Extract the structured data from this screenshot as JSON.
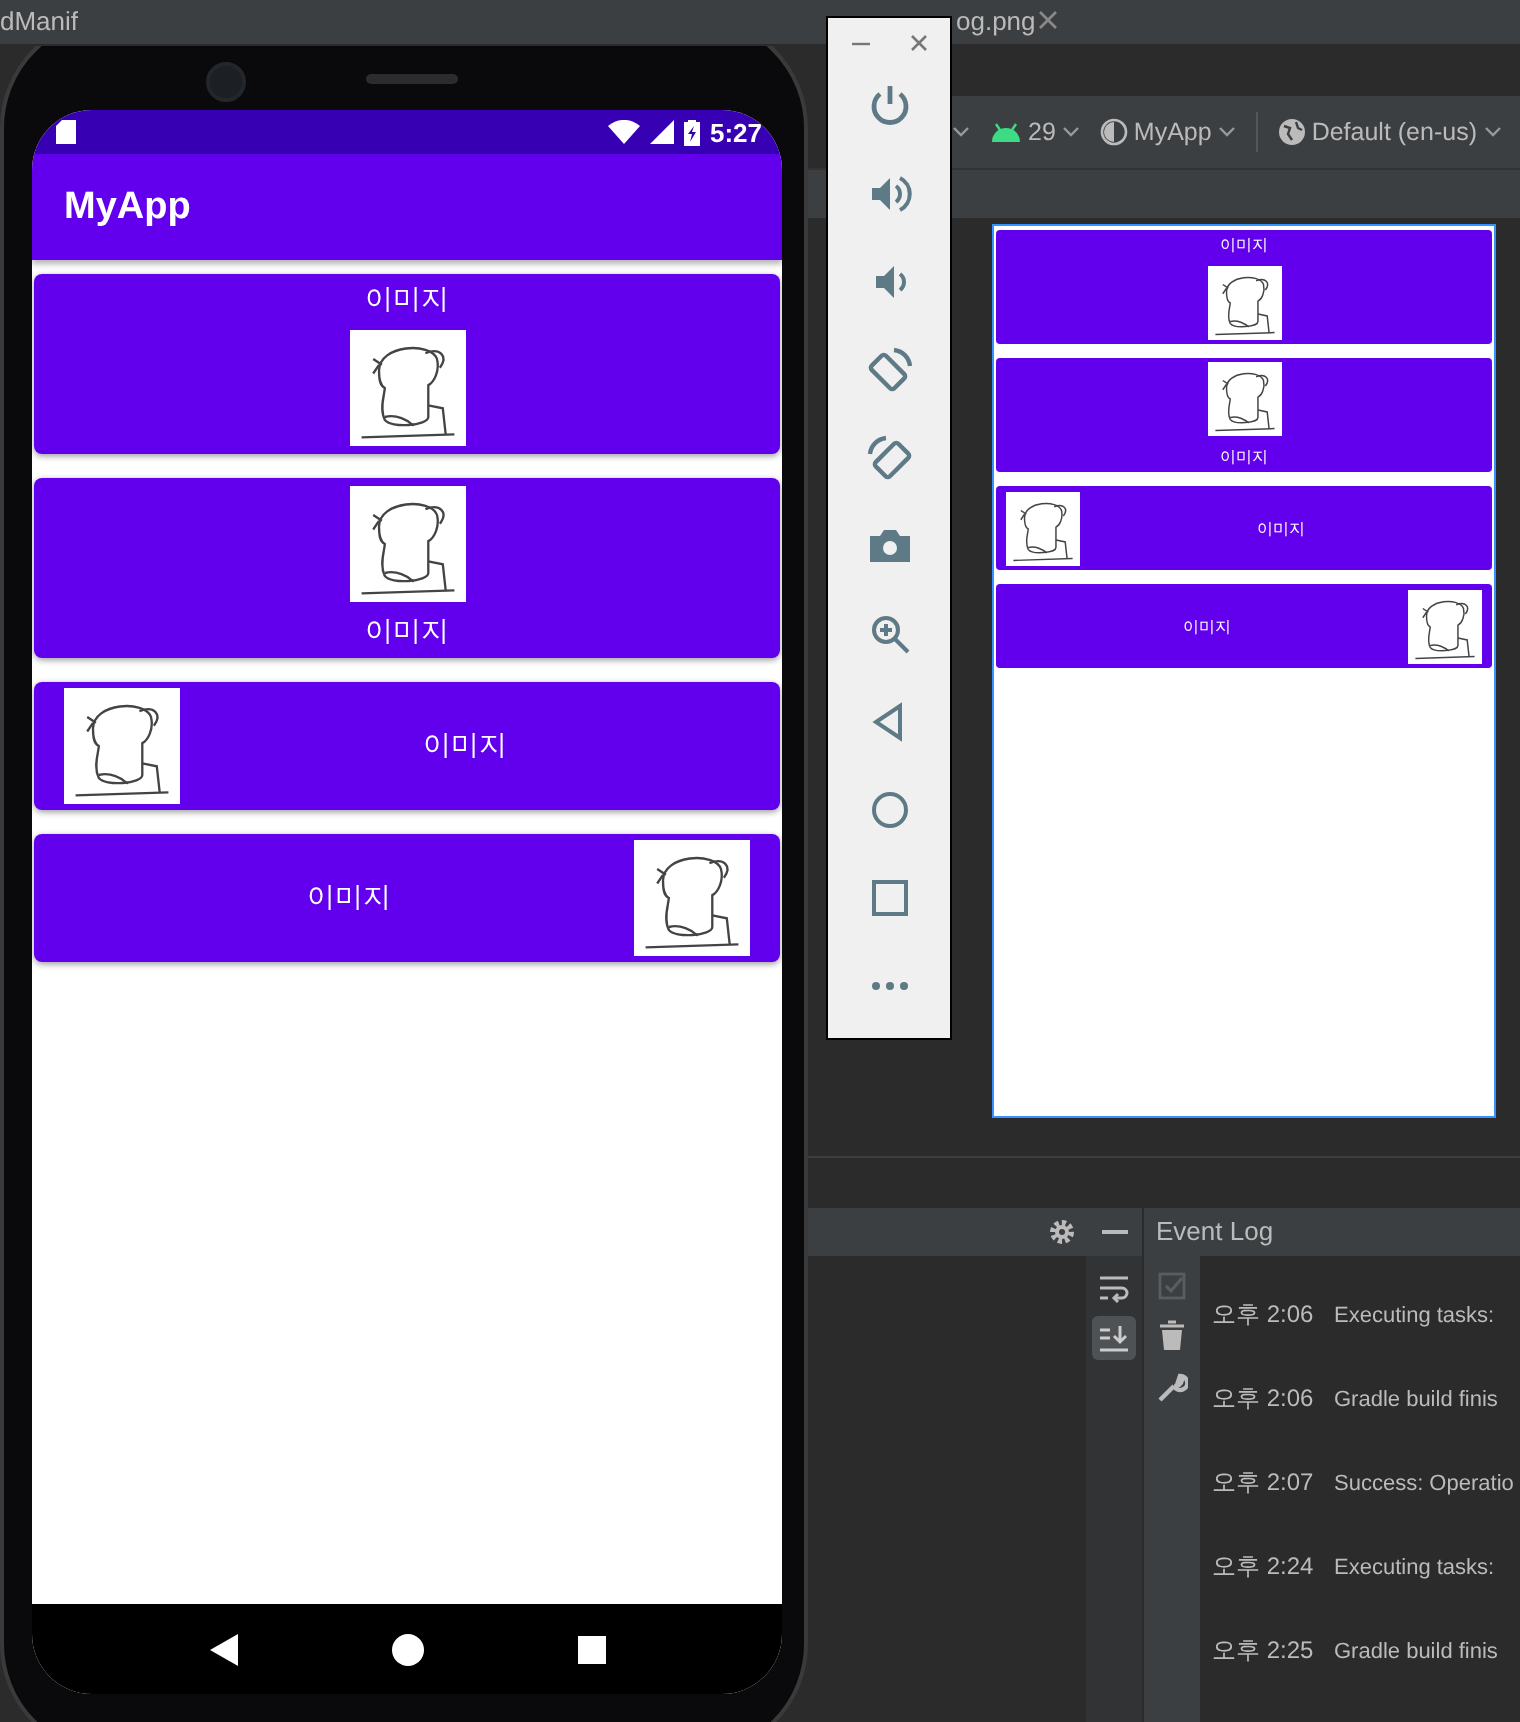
{
  "ide_tabs": [
    {
      "label": "dManif",
      "closable": false
    },
    {
      "label": "og.png",
      "closable": true
    }
  ],
  "toolbar": {
    "api_level": "29",
    "app": "MyApp",
    "locale": "Default (en-us)"
  },
  "device": {
    "status_bar": {
      "time": "5:27"
    },
    "app_bar": {
      "title": "MyApp"
    },
    "cards": [
      {
        "kind": "top",
        "label": "이미지"
      },
      {
        "kind": "bottom",
        "label": "이미지"
      },
      {
        "kind": "right",
        "label": "이미지"
      },
      {
        "kind": "left",
        "label": "이미지"
      }
    ]
  },
  "preview": {
    "cards": [
      {
        "kind": "top",
        "label": "이미지"
      },
      {
        "kind": "bottom",
        "label": "이미지"
      },
      {
        "kind": "right",
        "label": "이미지"
      },
      {
        "kind": "left",
        "label": "이미지"
      }
    ]
  },
  "event_log": {
    "title": "Event Log",
    "entries": [
      {
        "time": "오후 2:06",
        "message": "Executing tasks:"
      },
      {
        "time": "오후 2:06",
        "message": "Gradle build finis"
      },
      {
        "time": "오후 2:07",
        "message": "Success: Operatio"
      },
      {
        "time": "오후 2:24",
        "message": "Executing tasks:"
      },
      {
        "time": "오후 2:25",
        "message": "Gradle build finis"
      }
    ]
  }
}
